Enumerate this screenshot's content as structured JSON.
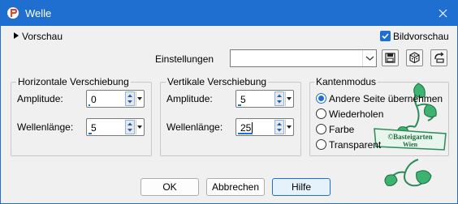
{
  "window": {
    "title": "Welle",
    "close_icon": "close-icon",
    "app_icon": "app-logo-icon"
  },
  "header": {
    "preview_toggle": "Vorschau",
    "bildvorschau": {
      "label": "Bildvorschau",
      "checked": true
    }
  },
  "settings": {
    "label": "Einstellungen",
    "value": "",
    "buttons": [
      "save-preset-icon",
      "dice-randomize-icon",
      "reset-default-icon"
    ]
  },
  "horizontal": {
    "legend": "Horizontale Verschiebung",
    "amplitude_label": "Amplitude:",
    "amplitude_value": "0",
    "amplitude_level": 0.0,
    "wavelength_label": "Wellenlänge:",
    "wavelength_value": "5",
    "wavelength_level": 0.05
  },
  "vertical": {
    "legend": "Vertikale Verschiebung",
    "amplitude_label": "Amplitude:",
    "amplitude_value": "5",
    "amplitude_level": 0.05,
    "wavelength_label": "Wellenlänge:",
    "wavelength_value": "25",
    "wavelength_level": 0.25
  },
  "edge_mode": {
    "legend": "Kantenmodus",
    "options": [
      {
        "label": "Andere Seite übernehmen",
        "selected": true
      },
      {
        "label": "Wiederholen",
        "selected": false
      },
      {
        "label": "Farbe",
        "selected": false
      },
      {
        "label": "Transparent",
        "selected": false
      }
    ]
  },
  "watermark": {
    "line1": "©Basteigarten",
    "line2": "Wien"
  },
  "footer": {
    "ok": "OK",
    "cancel": "Abbrechen",
    "help": "Hilfe"
  },
  "colors": {
    "accent": "#1f6fd0",
    "watermark_green": "#2e8b57"
  }
}
